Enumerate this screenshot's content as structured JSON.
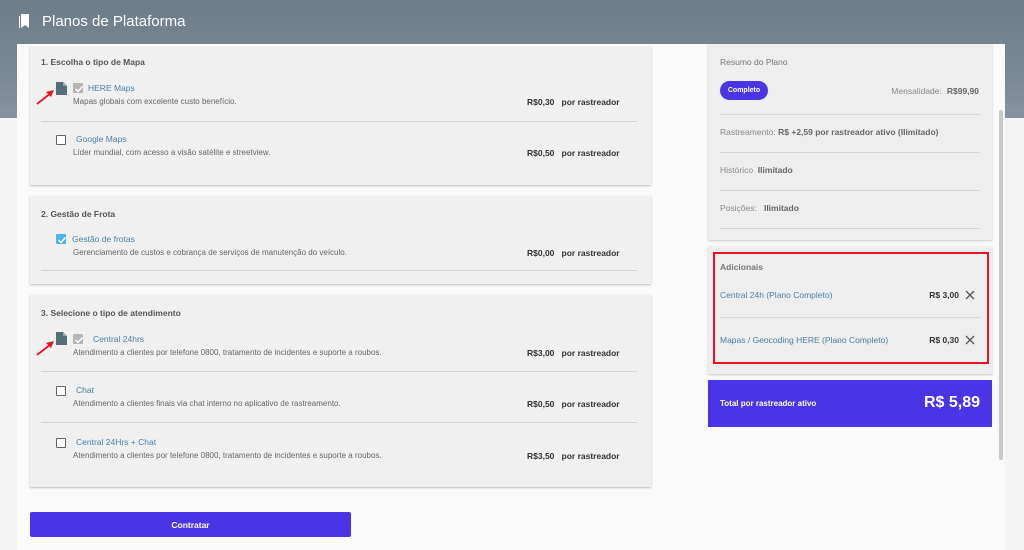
{
  "header": {
    "title": "Planos de Plataforma"
  },
  "sections": [
    {
      "title": "1. Escolha o tipo de Mapa",
      "options": [
        {
          "name": "HERE Maps",
          "description": "Mapas globais com excelente custo benefício.",
          "price": "R$0,30",
          "unit": "por rastreador",
          "checked": true
        },
        {
          "name": "Google Maps",
          "description": "Líder mundial, com acesso a visão satélite e streetview.",
          "price": "R$0,50",
          "unit": "por rastreador",
          "checked": false
        }
      ]
    },
    {
      "title": "2. Gestão de Frota",
      "options": [
        {
          "name": "Gestão de frotas",
          "description": "Gerenciamento de custos e cobrança de serviços de manutenção do veículo.",
          "price": "R$0,00",
          "unit": "por rastreador",
          "checked": true
        }
      ]
    },
    {
      "title": "3. Selecione o tipo de atendimento",
      "options": [
        {
          "name": "Central 24hrs",
          "description": "Atendimento a clientes por telefone 0800, tratamento de incidentes e suporte a roubos.",
          "price": "R$3,00",
          "unit": "por rastreador",
          "checked": true
        },
        {
          "name": "Chat",
          "description": "Atendimento a clientes finais via chat interno no aplicativo de rastreamento.",
          "price": "R$0,50",
          "unit": "por rastreador",
          "checked": false
        },
        {
          "name": "Central 24Hrs + Chat",
          "description": "Atendimento a clientes por telefone 0800, tratamento de incidentes e suporte a roubos.",
          "price": "R$3,50",
          "unit": "por rastreador",
          "checked": false
        }
      ]
    }
  ],
  "contract_button": "Contratar",
  "summary": {
    "title": "Resumo do Plano",
    "badge": "Completo",
    "monthly_label": "Mensalidade:",
    "monthly_value": "R$99,90",
    "tracking_label": "Rastreamento:",
    "tracking_value": "R$  +2,59 por rastreador ativo (Ilimitado)",
    "history_label": "Histórico",
    "history_value": "Ilimitado",
    "positions_label": "Posições:",
    "positions_value": "Ilimitado"
  },
  "addons": {
    "title": "Adicionais",
    "items": [
      {
        "name": "Central 24h (Plano Completo)",
        "price": "R$ 3,00"
      },
      {
        "name": "Mapas / Geocoding HERE (Plano Completo)",
        "price": "R$ 0,30"
      }
    ]
  },
  "total": {
    "label": "Total por rastreador ativo",
    "value": "R$ 5,89"
  },
  "colors": {
    "accent": "#4a35e6",
    "highlight": "#e8131c",
    "link": "#4b7fa8",
    "check_blue": "#4fb3ea"
  }
}
